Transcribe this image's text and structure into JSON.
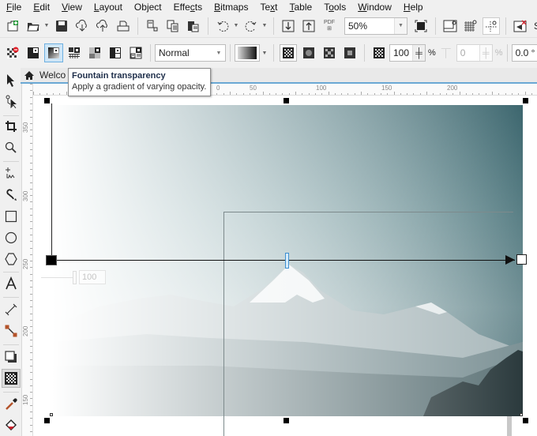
{
  "menu": [
    {
      "label": "File",
      "mnemonic": "F"
    },
    {
      "label": "Edit",
      "mnemonic": "E"
    },
    {
      "label": "View",
      "mnemonic": "V"
    },
    {
      "label": "Layout",
      "mnemonic": "L"
    },
    {
      "label": "Object",
      "mnemonic": "j"
    },
    {
      "label": "Effects",
      "mnemonic": "c"
    },
    {
      "label": "Bitmaps",
      "mnemonic": "B"
    },
    {
      "label": "Text",
      "mnemonic": "x"
    },
    {
      "label": "Table",
      "mnemonic": "T"
    },
    {
      "label": "Tools",
      "mnemonic": "o"
    },
    {
      "label": "Window",
      "mnemonic": "W"
    },
    {
      "label": "Help",
      "mnemonic": "H"
    }
  ],
  "standard_toolbar": {
    "zoom_level": "50%",
    "pdf_label": "PDF",
    "truncated_label": "S"
  },
  "property_bar": {
    "merge_mode": "Normal",
    "transparency": "100",
    "transparency_unit": "%",
    "midpoint": "0",
    "midpoint_unit": "%",
    "angle": "0.0 °"
  },
  "document_tab": {
    "label": "Welcome Screen",
    "visible_label": "Welco"
  },
  "tooltip": {
    "title": "Fountain transparency",
    "description": "Apply a gradient of varying opacity."
  },
  "rulers": {
    "horizontal": [
      "0",
      "50",
      "100",
      "150",
      "200"
    ],
    "vertical": [
      "350",
      "300",
      "250",
      "200",
      "150"
    ]
  },
  "on_canvas": {
    "node_transparency_value": "100"
  },
  "colors": {
    "accent": "#6aa8d4",
    "photo_dark": "#3d6a73"
  }
}
